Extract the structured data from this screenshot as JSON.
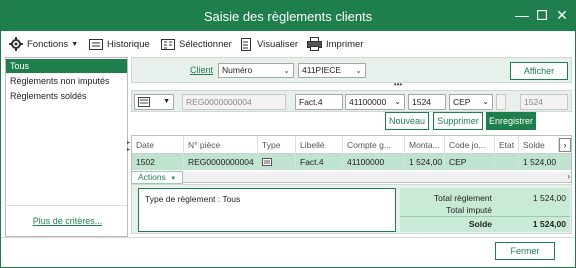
{
  "window": {
    "title": "Saisie des règlements clients"
  },
  "colors": {
    "accent": "#1f7f4c",
    "row_selected": "#bfe3cf",
    "totals_bg": "#c9ead7",
    "panel_bg": "#e8f0ec"
  },
  "toolbar": {
    "fonctions": "Fonctions",
    "historique": "Historique",
    "selectionner": "Sélectionner",
    "visualiser": "Visualiser",
    "imprimer": "Imprimer"
  },
  "left_panel": {
    "items": [
      "Tous",
      "Règlements non imputés",
      "Règlements soldés"
    ],
    "more_link": "Plus de critères..."
  },
  "filter": {
    "client_label": "Client",
    "field_select": "Numéro",
    "client_value": "411PIECE",
    "afficher": "Afficher"
  },
  "entry": {
    "piece": "REG0000000004",
    "libelle": "Fact.4",
    "compte": "41100000",
    "montant": "1524",
    "code_journal": "CEP",
    "solde": "1524"
  },
  "actions_bar": {
    "nouveau": "Nouveau",
    "supprimer": "Supprimer",
    "enregistrer": "Enregistrer"
  },
  "grid": {
    "columns": [
      "Date",
      "N° pièce",
      "Type",
      "Libellé",
      "Compte g...",
      "Monta...",
      "Code jo...",
      "Etat",
      "Solde"
    ],
    "rows": [
      {
        "date": "1502",
        "piece": "REG0000000004",
        "type_icon": "card-icon",
        "libelle": "Fact.4",
        "compte": "41100000",
        "montant": "1 524,00",
        "code": "CEP",
        "etat": "",
        "solde": "1 524,00"
      }
    ]
  },
  "actions_menu": "Actions",
  "type_reglement": "Type de règlement : Tous",
  "totals": {
    "total_reglement_label": "Total règlement",
    "total_reglement_value": "1 524,00",
    "total_impute_label": "Total imputé",
    "total_impute_value": "",
    "solde_label": "Solde",
    "solde_value": "1 524,00"
  },
  "footer": {
    "fermer": "Fermer"
  }
}
